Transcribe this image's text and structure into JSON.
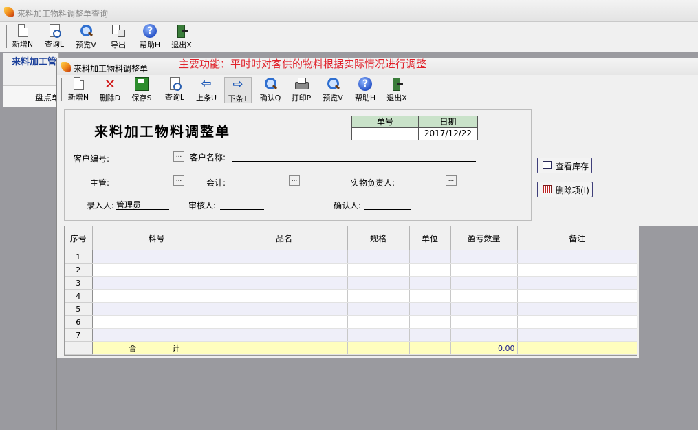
{
  "outer": {
    "title": "来料加工物料调整单查询",
    "toolbar": [
      "新增N",
      "查询L",
      "预览V",
      "导出",
      "帮助H",
      "退出X"
    ]
  },
  "left_panel": {
    "title": "来料加工管",
    "tab_label": "盘点单"
  },
  "inner": {
    "title": "来料加工物料调整单",
    "toolbar": [
      "新增N",
      "删除D",
      "保存S",
      "查询L",
      "上条U",
      "下条T",
      "确认Q",
      "打印P",
      "预览V",
      "帮助H",
      "退出X"
    ],
    "notice": "主要功能：平时时对客供的物料根据实际情况进行调整"
  },
  "form": {
    "title": "来料加工物料调整单",
    "doc_no_label": "单号",
    "date_label": "日期",
    "doc_no": "",
    "date": "2017/12/22",
    "customer_code_label": "客户编号:",
    "customer_name_label": "客户名称:",
    "supervisor_label": "主管:",
    "accountant_label": "会计:",
    "responsible_label": "实物负责人:",
    "entered_by_label": "录入人:",
    "entered_by": "管理员",
    "reviewer_label": "审核人:",
    "confirmer_label": "确认人:",
    "lookup_button": "..."
  },
  "side_buttons": {
    "view_stock": "查看库存",
    "delete_item": "删除项(I)"
  },
  "grid": {
    "columns": [
      "序号",
      "料号",
      "品名",
      "规格",
      "单位",
      "盈亏数量",
      "备注"
    ],
    "rows": [
      "1",
      "2",
      "3",
      "4",
      "5",
      "6",
      "7"
    ],
    "total_label_1": "合",
    "total_label_2": "计",
    "total_qty": "0.00"
  }
}
